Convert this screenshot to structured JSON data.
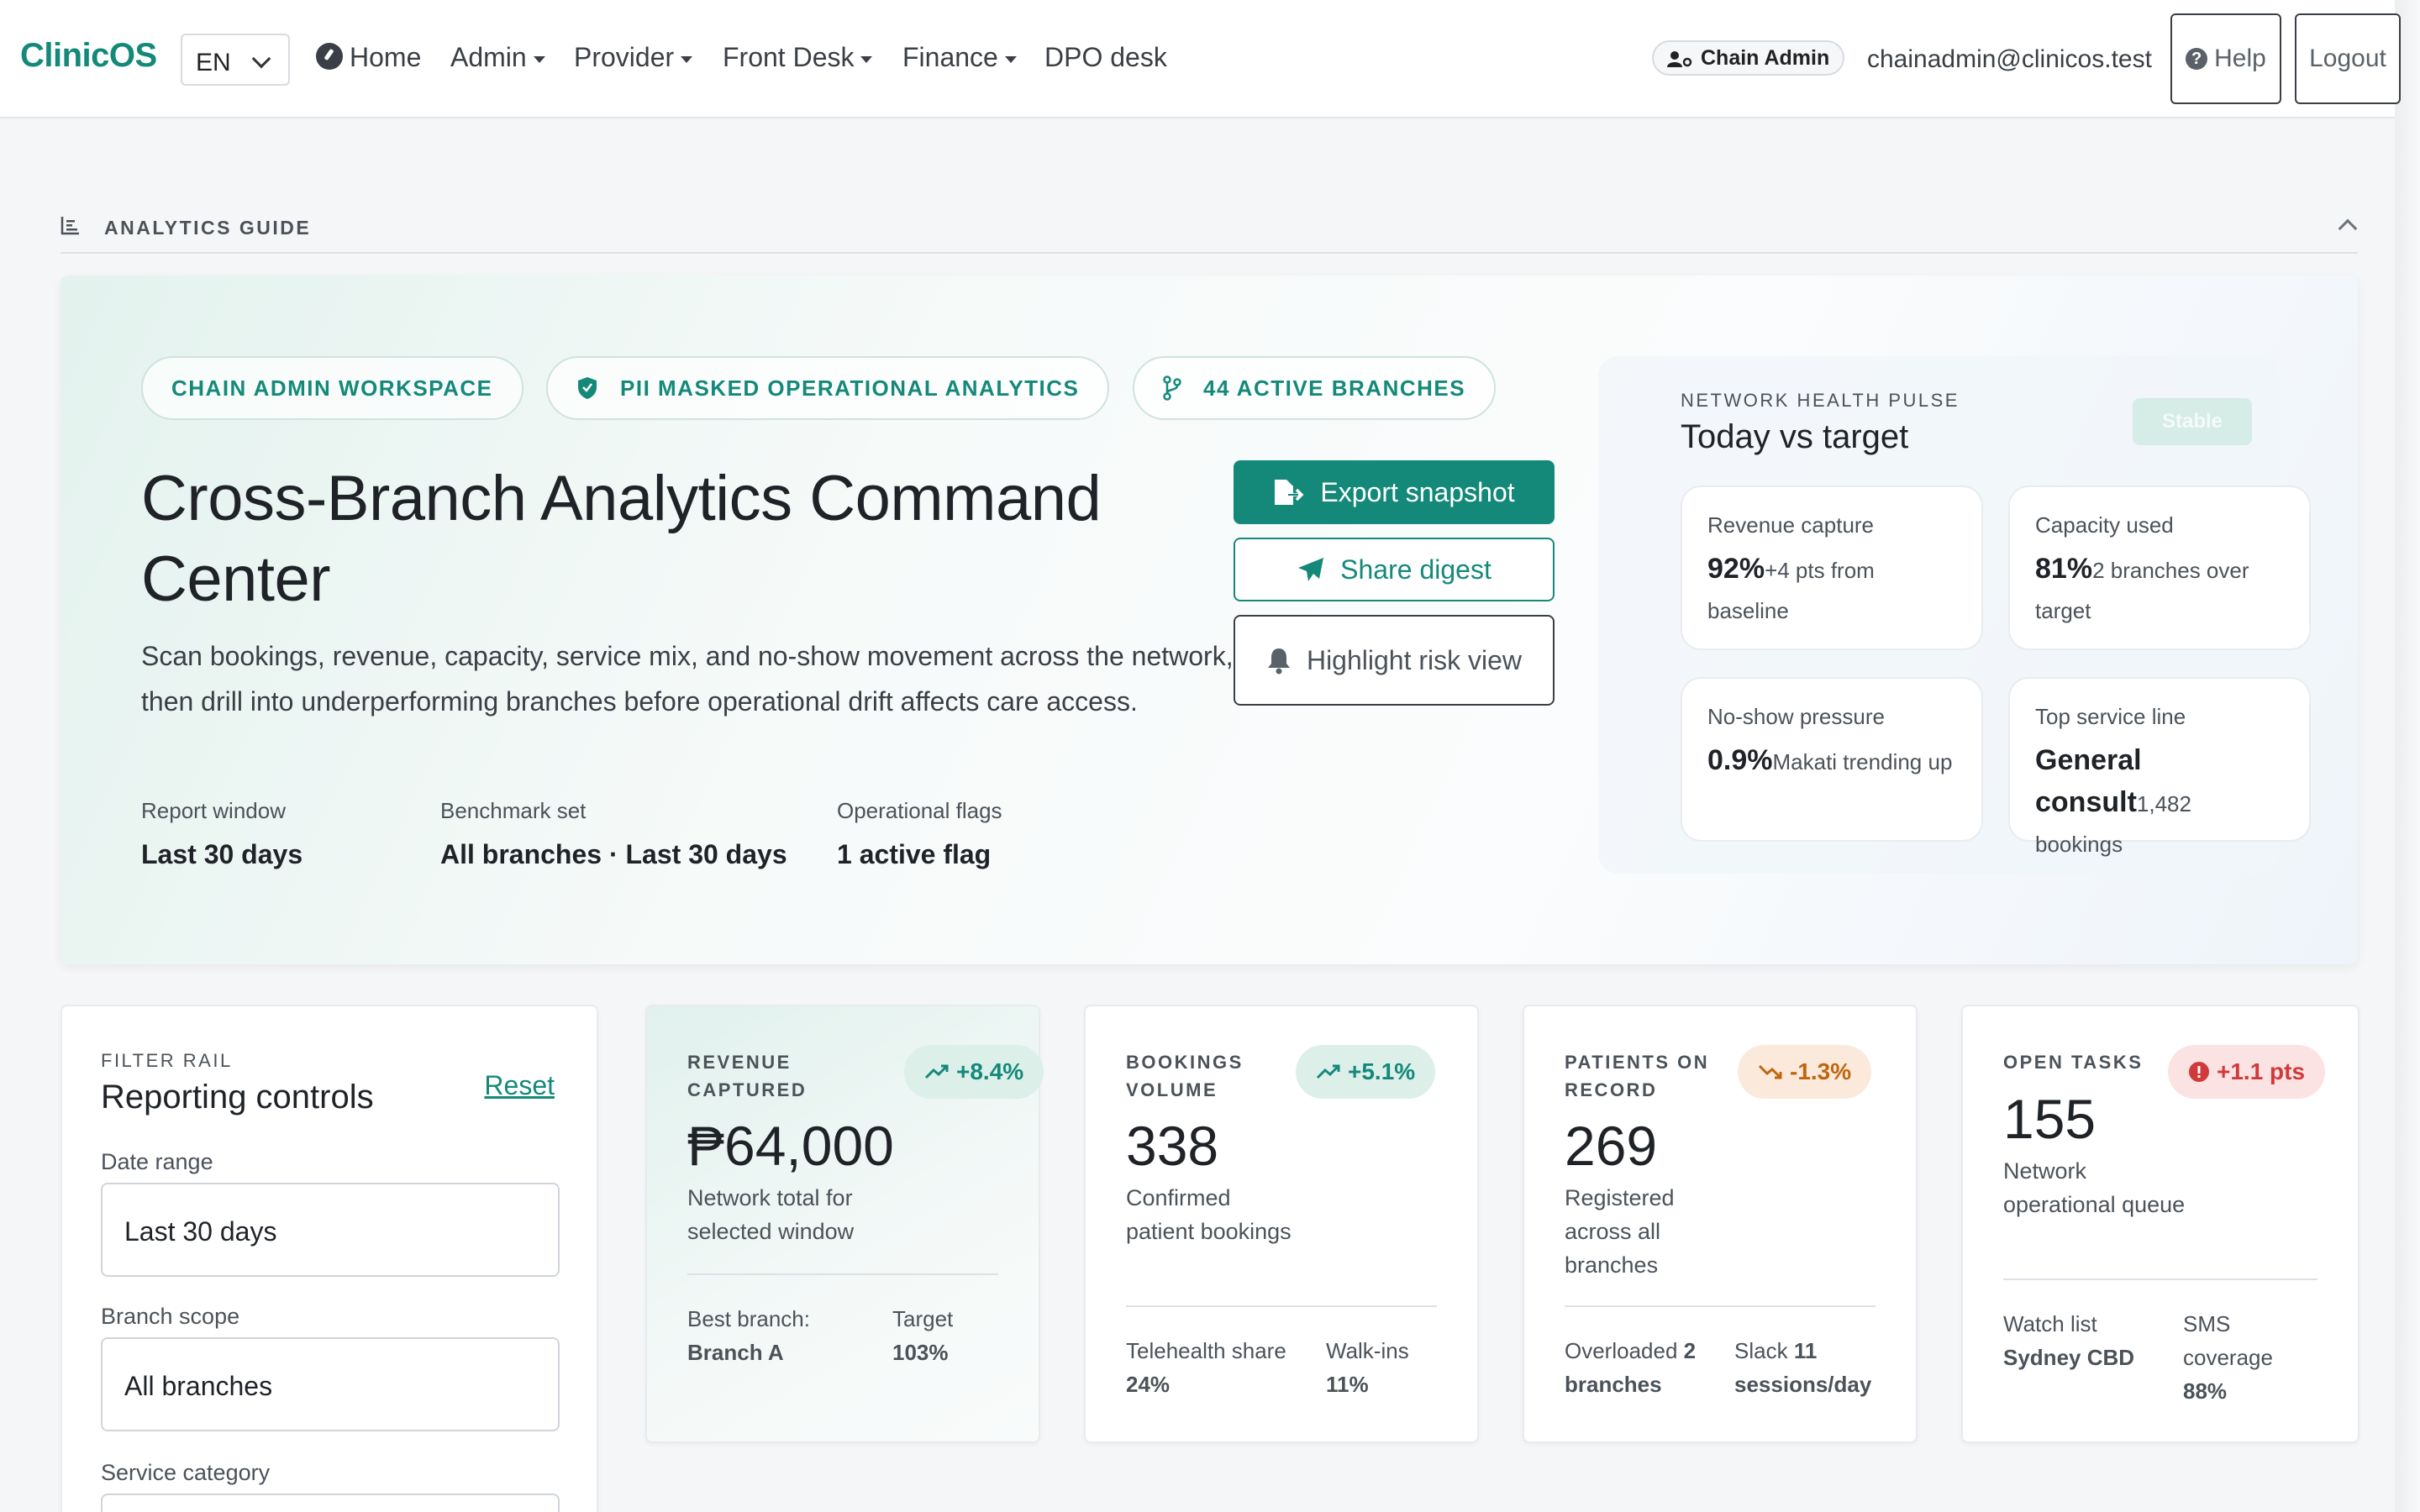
{
  "navbar": {
    "brand": "ClinicOS",
    "language": "EN",
    "items": [
      {
        "label": "Home"
      },
      {
        "label": "Admin"
      },
      {
        "label": "Provider"
      },
      {
        "label": "Front Desk"
      },
      {
        "label": "Finance"
      },
      {
        "label": "DPO desk"
      }
    ],
    "role": "Chain Admin",
    "email": "chainadmin@clinicos.test",
    "help_label": "Help",
    "logout_label": "Logout"
  },
  "guide": {
    "title": "ANALYTICS GUIDE"
  },
  "hero": {
    "chips": [
      {
        "label": "CHAIN ADMIN WORKSPACE"
      },
      {
        "label": "PII MASKED OPERATIONAL ANALYTICS"
      },
      {
        "label": "44 ACTIVE BRANCHES"
      }
    ],
    "title": "Cross-Branch Analytics Command Center",
    "description": "Scan bookings, revenue, capacity, service mix, and no-show movement across the network, then drill into underperforming branches before operational drift affects care access.",
    "meta": [
      {
        "label": "Report window",
        "value": "Last 30 days"
      },
      {
        "label": "Benchmark set",
        "value": "All branches · Last 30 days"
      },
      {
        "label": "Operational flags",
        "value": "1 active flag"
      }
    ],
    "actions": {
      "export": "Export snapshot",
      "share": "Share digest",
      "risk": "Highlight risk view"
    }
  },
  "pulse": {
    "kicker": "NETWORK HEALTH PULSE",
    "heading": "Today vs target",
    "status": "Stable",
    "metrics": [
      {
        "label": "Revenue capture",
        "value": "92%",
        "note": "+4 pts from baseline"
      },
      {
        "label": "Capacity used",
        "value": "81%",
        "note": "2 branches over target"
      },
      {
        "label": "No-show pressure",
        "value": "0.9%",
        "note": "Makati trending up"
      },
      {
        "label": "Top service line",
        "value": "General consult",
        "note": "1,482 bookings"
      }
    ]
  },
  "filters": {
    "kicker": "FILTER RAIL",
    "heading": "Reporting controls",
    "reset": "Reset",
    "date_label": "Date range",
    "date_value": "Last 30 days",
    "branch_label": "Branch scope",
    "branch_value": "All branches",
    "service_label": "Service category"
  },
  "kpis": {
    "revenue": {
      "kicker": "REVENUE CAPTURED",
      "trend": "+8.4%",
      "value": "₱64,000",
      "sub": "Network total for selected window",
      "foot1_label": "Best branch:",
      "foot1_value": "Branch A",
      "foot2_label": "Target",
      "foot2_value": "103%"
    },
    "bookings": {
      "kicker": "BOOKINGS VOLUME",
      "trend": "+5.1%",
      "value": "338",
      "sub": "Confirmed patient bookings",
      "foot1_label": "Telehealth share",
      "foot1_value": "24%",
      "foot2_label": "Walk-ins",
      "foot2_value": "11%"
    },
    "patients": {
      "kicker": "PATIENTS ON RECORD",
      "trend": "-1.3%",
      "value": "269",
      "sub": "Registered across all branches",
      "foot1_label": "Overloaded",
      "foot1_value": "2 branches",
      "foot2_label": "Slack",
      "foot2_value": "11 sessions/day"
    },
    "tasks": {
      "kicker": "OPEN TASKS",
      "trend": "+1.1 pts",
      "value": "155",
      "sub": "Network operational queue",
      "foot1_label": "Watch list",
      "foot1_value": "Sydney CBD",
      "foot2_label": "SMS coverage",
      "foot2_value": "88%"
    }
  },
  "colors": {
    "accent": "#14897a",
    "trend_up": "#14897a",
    "trend_down": "#c0650e",
    "alert": "#d13a3a"
  }
}
